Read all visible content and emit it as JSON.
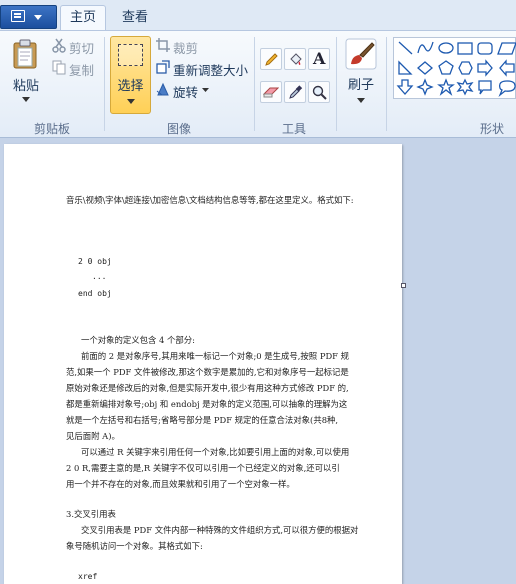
{
  "tabs": {
    "home": "主页",
    "view": "查看"
  },
  "clipboard": {
    "paste": "粘贴",
    "cut": "剪切",
    "copy": "复制",
    "group": "剪贴板"
  },
  "image": {
    "select": "选择",
    "crop": "裁剪",
    "resize": "重新调整大小",
    "rotate": "旋转",
    "group": "图像"
  },
  "tools": {
    "group": "工具"
  },
  "brushes": {
    "label": "刷子"
  },
  "shapes": {
    "group": "形状"
  },
  "document": {
    "lines": [
      "音乐\\视频\\字体\\超连接\\加密信息\\文档结构信息等等,都在这里定义。格式如下:",
      "2 0 obj",
      "...",
      "end obj",
      "一个对象的定义包含 4 个部分:",
      "前面的 2 是对象序号,其用来唯一标记一个对象;0 是生成号,按照 PDF 规",
      "范,如果一个 PDF 文件被修改,那这个数字是累加的,它和对象序号一起标记是",
      "原始对象还是修改后的对象,但是实际开发中,很少有用这种方式修改 PDF 的,",
      "都是重新编排对象号;obj 和 endobj 是对象的定义范围,可以抽象的理解为这",
      "就是一个左括号和右括号;省略号部分是 PDF 规定的任意合法对象(共8种,",
      "见后面附 A)。",
      "可以通过 R 关键字来引用任何一个对象,比如要引用上面的对象,可以使用",
      "2 0 R,需要主意的是,R 关键字不仅可以引用一个已经定义的对象,还可以引",
      "用一个并不存在的对象,而且效果就和引用了一个空对象一样。",
      "3.交叉引用表",
      "交叉引用表是 PDF 文件内部一种特殊的文件组织方式,可以很方便的根据对",
      "象号随机访问一个对象。其格式如下:",
      "xref"
    ]
  }
}
